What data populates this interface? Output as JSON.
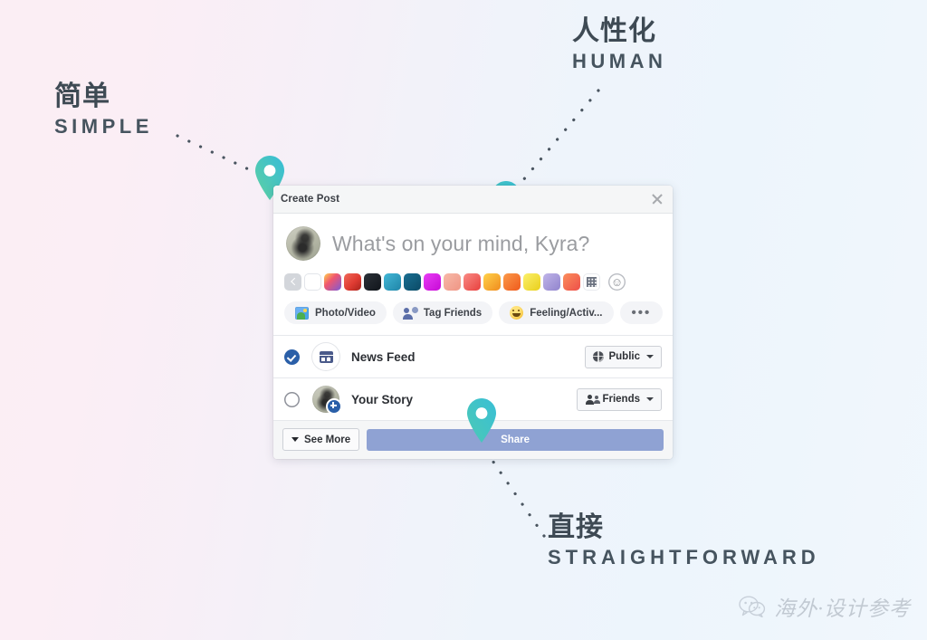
{
  "background": {
    "gradient_from": "#fbeef4",
    "gradient_to": "#f1f7fd"
  },
  "annotations": [
    {
      "id": "simple",
      "cn": "简单",
      "en": "SIMPLE",
      "color": "#3e4a54",
      "pin_target": "create-post-header"
    },
    {
      "id": "human",
      "cn": "人性化",
      "en": "HUMAN",
      "color": "#3e4a54",
      "pin_target": "compose-placeholder"
    },
    {
      "id": "straightforward",
      "cn": "直接",
      "en": "STRAIGHTFORWARD",
      "color": "#3e4a54",
      "pin_target": "share-button"
    }
  ],
  "pin": {
    "gradient_start": "#5fd1a0",
    "gradient_end": "#36bcd8",
    "icon_name": "map-pin-icon"
  },
  "modal": {
    "title": "Create Post",
    "close_icon": "close-icon",
    "compose": {
      "placeholder": "What's on your mind, Kyra?",
      "avatar_name": "user-avatar"
    },
    "swatches": [
      {
        "name": "back-arrow",
        "type": "back",
        "color": "#d3d6db"
      },
      {
        "name": "plain-white",
        "type": "plain",
        "color": "#ffffff"
      },
      {
        "name": "colorful-burst",
        "type": "color",
        "color": "#e9497a",
        "gradient": "linear-gradient(135deg,#ffd34e 0%,#f0566f 40%,#7b5bd6 100%)"
      },
      {
        "name": "red-swirl",
        "type": "color",
        "color": "#e6433c",
        "gradient": "linear-gradient(135deg,#f06a5a 0%,#df3b32 55%,#a8231c 100%)"
      },
      {
        "name": "dark-cloud",
        "type": "color",
        "color": "#1b1f26",
        "gradient": "linear-gradient(135deg,#2b3138 0%,#11151b 100%)"
      },
      {
        "name": "teal-paper",
        "type": "color",
        "color": "#2f9fc4",
        "gradient": "linear-gradient(135deg,#43b7d6 0%,#1f85a8 100%)"
      },
      {
        "name": "navy-blue",
        "type": "color",
        "color": "#115e7e",
        "gradient": "linear-gradient(135deg,#1a6f92 0%,#0b4a66 100%)"
      },
      {
        "name": "magenta",
        "type": "color",
        "color": "#d916e8",
        "gradient": "linear-gradient(135deg,#e83df5 0%,#c70ad6 100%)"
      },
      {
        "name": "peach-eye",
        "type": "color",
        "color": "#f0a090",
        "gradient": "linear-gradient(135deg,#f7b9a8 0%,#ef9585 100%)"
      },
      {
        "name": "red-heart",
        "type": "color",
        "color": "#f2635f",
        "gradient": "linear-gradient(135deg,#f98b85 0%,#e8403e 100%)"
      },
      {
        "name": "smiley-yellow",
        "type": "color",
        "color": "#f5a623",
        "gradient": "linear-gradient(135deg,#ffd24a 0%,#f08c1e 100%)"
      },
      {
        "name": "orange-flame",
        "type": "color",
        "color": "#f4712c",
        "gradient": "linear-gradient(135deg,#fb9a4a 0%,#ef5a1c 100%)"
      },
      {
        "name": "yellow-confetti",
        "type": "color",
        "color": "#f3e03a",
        "gradient": "linear-gradient(135deg,#fbf06a 0%,#e9cf1c 100%)"
      },
      {
        "name": "lavender",
        "type": "color",
        "color": "#a79ada",
        "gradient": "linear-gradient(135deg,#bfb4e8 0%,#9184cd 100%)"
      },
      {
        "name": "coral-sun",
        "type": "color",
        "color": "#f26d5b",
        "gradient": "linear-gradient(135deg,#fb8e5c 0%,#ee4f49 100%)"
      },
      {
        "name": "grid-more",
        "type": "grid",
        "color": "#ffffff"
      }
    ],
    "emoji_button": {
      "name": "emoji-picker",
      "glyph": "☺"
    },
    "actions": [
      {
        "name": "photo-video",
        "label": "Photo/Video",
        "icon": "photo-video-icon"
      },
      {
        "name": "tag-friends",
        "label": "Tag Friends",
        "icon": "tag-friends-icon"
      },
      {
        "name": "feeling-activity",
        "label": "Feeling/Activ...",
        "icon": "feeling-icon"
      },
      {
        "name": "more-options",
        "label": "•••",
        "icon": "ellipsis-icon"
      }
    ],
    "destinations": [
      {
        "name": "news-feed",
        "label": "News Feed",
        "selected": true,
        "icon": "news-feed-icon",
        "audience": {
          "label": "Public",
          "icon": "globe-icon"
        }
      },
      {
        "name": "your-story",
        "label": "Your Story",
        "selected": false,
        "icon": "story-avatar-icon",
        "audience": {
          "label": "Friends",
          "icon": "friends-icon"
        }
      }
    ],
    "footer": {
      "see_more_label": "See More",
      "share_label": "Share",
      "share_color": "#8fa2d3"
    }
  },
  "watermark": {
    "text": "海外·设计参考",
    "icon": "wechat-icon"
  }
}
